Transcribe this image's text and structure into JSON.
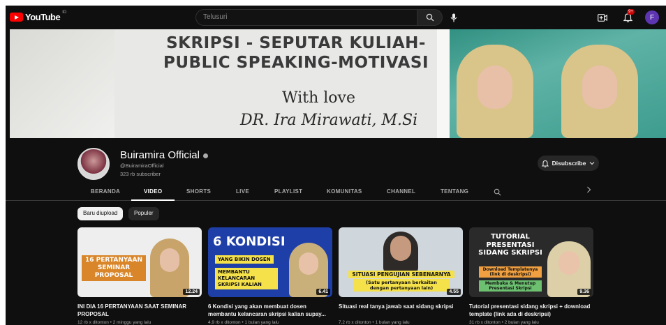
{
  "topbar": {
    "logo_text": "YouTube",
    "logo_country": "ID",
    "search_placeholder": "Telusuri",
    "notification_count": "9+",
    "avatar_letter": "F"
  },
  "banner": {
    "headline_line1": "SKRIPSI - SEPUTAR KULIAH-",
    "headline_line2": "PUBLIC SPEAKING-MOTIVASI",
    "with_love": "With love",
    "signature": "DR. Ira Mirawati, M.Si"
  },
  "channel": {
    "name": "Buiramira Official",
    "handle": "@BuiramiraOfficial",
    "subscribers": "323 rb subscriber",
    "subscribe_label": "Disubscribe"
  },
  "tabs": [
    {
      "label": "BERANDA"
    },
    {
      "label": "VIDEO"
    },
    {
      "label": "SHORTS"
    },
    {
      "label": "LIVE"
    },
    {
      "label": "PLAYLIST"
    },
    {
      "label": "KOMUNITAS"
    },
    {
      "label": "CHANNEL"
    },
    {
      "label": "TENTANG"
    }
  ],
  "chips": {
    "latest": "Baru diupload",
    "popular": "Populer"
  },
  "videos": [
    {
      "thumb_text": "16 PERTANYAAN SEMINAR PROPOSAL",
      "duration": "12.24",
      "title": "INI DIA 16 PERTANYAAN SAAT SEMINAR PROPOSAL",
      "meta": "12 rb x ditonton • 2 minggu yang lalu"
    },
    {
      "thumb_text": "6 KONDISI",
      "thumb_sub1": "YANG BIKIN DOSEN",
      "thumb_sub2": "MEMBANTU KELANCARAN SKRIPSI KALIAN",
      "duration": "6.41",
      "title": "6 Kondisi yang akan membuat dosen membantu kelancaran skripsi kalian supay...",
      "meta": "4,9 rb x ditonton • 1 bulan yang lalu"
    },
    {
      "thumb_text": "SITUASI PENGUJIAN SEBENARNYA",
      "thumb_sub1": "(Satu pertanyaan berkaitan dengan pertanyaan lain)",
      "duration": "4.55",
      "title": "Situasi real tanya jawab saat sidang skripsi",
      "meta": "7,2 rb x ditonton • 1 bulan yang lalu"
    },
    {
      "thumb_text": "TUTORIAL PRESENTASI SIDANG SKRIPSI",
      "thumb_sub1": "Download Templatenya (link di deskripsi)",
      "thumb_sub2": "Membuka & Menutup Presentasi Skripsi",
      "duration": "9.36",
      "title": "Tutorial presentasi sidang skripsi + download template (link ada di deskripsi)",
      "meta": "31 rb x ditonton • 2 bulan yang lalu"
    }
  ]
}
